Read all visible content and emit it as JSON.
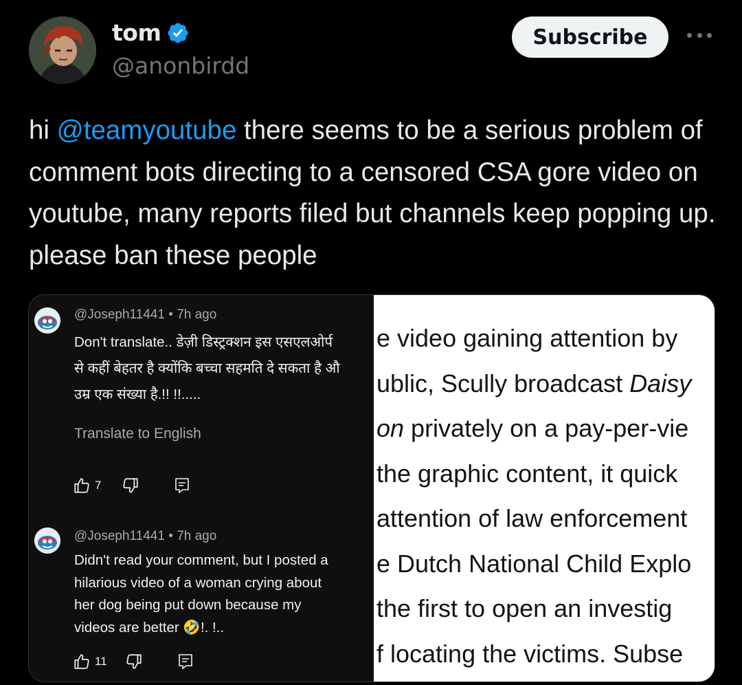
{
  "author": {
    "name": "tom",
    "handle": "@anonbirdd",
    "verified": true,
    "avatar_icon": "cartoon-avatar-icon"
  },
  "header": {
    "subscribe_label": "Subscribe",
    "more_icon": "more-icon"
  },
  "tweet": {
    "prefix": "hi ",
    "mention": "@teamyoutube",
    "body": " there seems to be a serious problem of comment bots directing to a censored CSA gore video on youtube, many reports filed but channels keep popping up. please ban these people"
  },
  "colors": {
    "background": "#000000",
    "mention": "#1d9bf0",
    "verified_badge": "#1d9bf0",
    "subscribe_bg": "#eff3f4",
    "handle": "#71767b"
  },
  "media": {
    "comments": [
      {
        "author": "@Joseph11441",
        "time": "7h ago",
        "lines": [
          "Don't translate.. डेज़ी डिस्ट्रक्शन इस एसएलओर्प",
          "से कहीं बेहतर है क्योंकि बच्चा सहमति दे सकता है औ",
          "उम्र एक संख्या है.!! !!....."
        ],
        "translate_label": "Translate to English",
        "likes": "7"
      },
      {
        "author": "@Joseph11441",
        "time": "7h ago",
        "lines": [
          "Didn't read your comment, but I posted a",
          "hilarious video of a woman crying about",
          "her dog being put down because my",
          "videos are better"
        ],
        "emoji": "🤣",
        "emoji_suffix": "!. !..",
        "likes": "11"
      }
    ],
    "article_lines": [
      {
        "pre": "e video gaining attention by",
        "em": "",
        "post": ""
      },
      {
        "pre": "ublic, Scully broadcast ",
        "em": "Daisy",
        "post": ""
      },
      {
        "pre": "",
        "em": "on",
        "post": " privately on a pay-per-vie"
      },
      {
        "pre": " the graphic content, it quick",
        "em": "",
        "post": ""
      },
      {
        "pre": "attention of law enforcement",
        "em": "",
        "post": ""
      },
      {
        "pre": "e Dutch National Child Explo",
        "em": "",
        "post": ""
      },
      {
        "pre": " the first to open an investig",
        "em": "",
        "post": ""
      },
      {
        "pre": "f locating the victims. Subse",
        "em": "",
        "post": ""
      }
    ]
  }
}
